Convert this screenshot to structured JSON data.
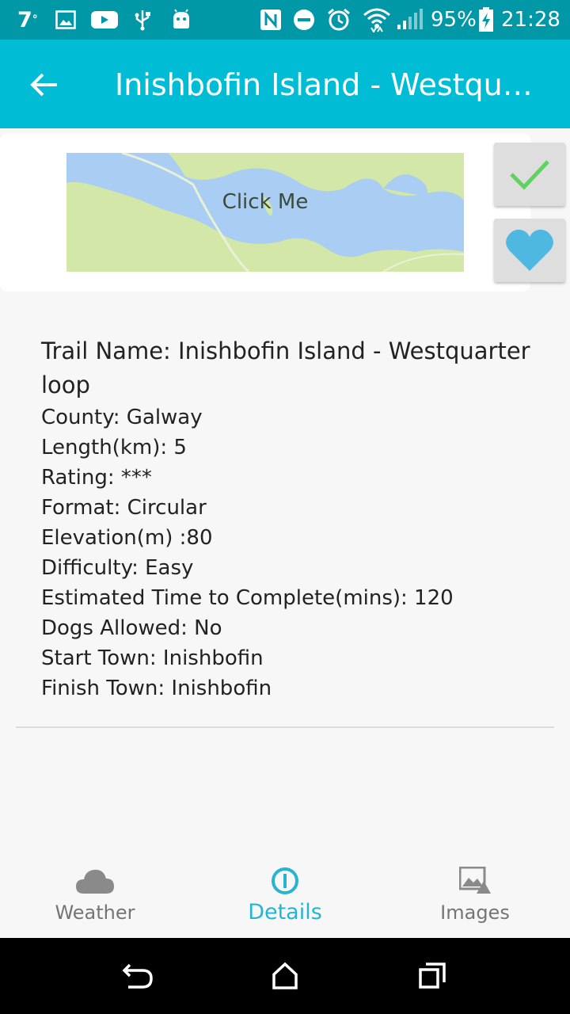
{
  "status_bar": {
    "temperature": "7",
    "degree": "°",
    "battery": "95%",
    "time": "21:28"
  },
  "app_bar": {
    "title": "Inishbofin Island - Westquarter loop"
  },
  "map": {
    "click_label": "Click Me"
  },
  "actions": {
    "check_color": "#5fd35f",
    "heart_color": "#4fb8e0"
  },
  "details": {
    "name": "Trail Name: Inishbofin Island - Westquarter loop",
    "county": "County: Galway",
    "length": "Length(km): 5",
    "rating": "Rating: ***",
    "format": "Format: Circular",
    "elevation": "Elevation(m) :80",
    "difficulty": "Difficulty: Easy",
    "time": "Estimated Time to Complete(mins): 120",
    "dogs": "Dogs Allowed: No",
    "start": "Start Town: Inishbofin",
    "finish": "Finish Town: Inishbofin"
  },
  "bottom_nav": {
    "weather": "Weather",
    "details": "Details",
    "images": "Images",
    "active_color": "#26b5d1"
  },
  "colors": {
    "status_bar": "#0097a7",
    "app_bar": "#00bcd4",
    "map_land": "#d3e8a8",
    "map_water": "#a9cdf3"
  }
}
